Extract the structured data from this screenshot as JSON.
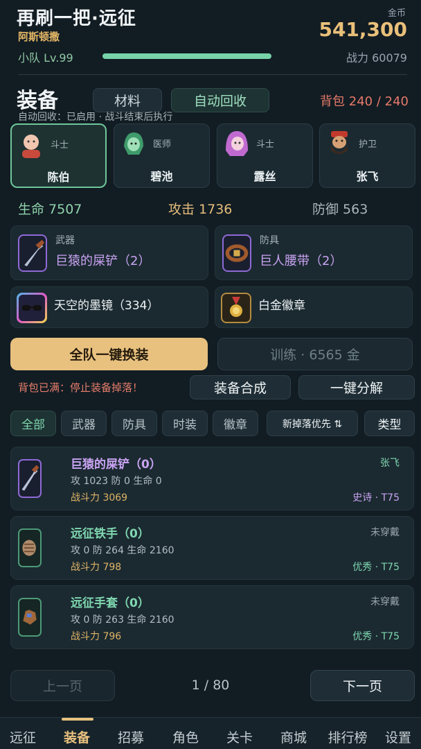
{
  "header": {
    "title": "再刷一把·远征",
    "player_name": "阿斯顿撒",
    "gold_label": "金币",
    "gold_value": "541,300",
    "team_level": "小队 Lv.99",
    "xp_progress": 1.0,
    "combat_power": "战力 60079"
  },
  "equipment": {
    "title": "装备",
    "tab_materials": "材料",
    "tab_auto_recycle": "自动回收",
    "bag_status": "背包 240 / 240",
    "auto_note": "自动回收：已启用 · 战斗结束后执行"
  },
  "heroes": [
    {
      "role": "斗士",
      "name": "陈伯",
      "selected": true
    },
    {
      "role": "医师",
      "name": "碧池",
      "selected": false
    },
    {
      "role": "斗士",
      "name": "露丝",
      "selected": false
    },
    {
      "role": "护卫",
      "name": "张飞",
      "selected": false
    }
  ],
  "stats": {
    "hp": "生命 7507",
    "atk": "攻击 1736",
    "def": "防御 563"
  },
  "slots": {
    "weapon": {
      "category": "武器",
      "name": "巨猿的屎铲（2）"
    },
    "armor": {
      "category": "防具",
      "name": "巨人腰带（2）"
    },
    "fashion": {
      "name": "天空的墨镜（334）"
    },
    "badge": {
      "name": "白金徽章"
    }
  },
  "actions": {
    "equip_all": "全队一键换装",
    "train": "训练 · 6565 金",
    "bag_full_warning": "背包已满：停止装备掉落！",
    "synthesize": "装备合成",
    "decompose": "一键分解"
  },
  "filters": {
    "all": "全部",
    "weapon": "武器",
    "armor": "防具",
    "fashion": "时装",
    "badge": "徽章",
    "sort": "新掉落优先 ⇅",
    "type": "类型"
  },
  "items": [
    {
      "name": "巨猿的屎铲（0）",
      "stats": "攻 1023  防 0  生命 0",
      "power": "战斗力 3069",
      "owner": "张飞",
      "rarity": "史诗 · T75"
    },
    {
      "name": "远征铁手（0）",
      "stats": "攻 0  防 264  生命 2160",
      "power": "战斗力 798",
      "owner": "未穿戴",
      "rarity": "优秀 · T75"
    },
    {
      "name": "远征手套（0）",
      "stats": "攻 0  防 263  生命 2160",
      "power": "战斗力 796",
      "owner": "未穿戴",
      "rarity": "优秀 · T75"
    }
  ],
  "pagination": {
    "prev": "上一页",
    "indicator": "1 / 80",
    "next": "下一页"
  },
  "nav": [
    "远征",
    "装备",
    "招募",
    "角色",
    "关卡",
    "商城",
    "排行榜",
    "设置"
  ],
  "colors": {
    "accent_gold": "#e8c17f",
    "accent_green": "#77d3a9",
    "epic_purple": "#c9a3f2",
    "good_green": "#7fd7b0",
    "warning_red": "#e67e6b"
  }
}
